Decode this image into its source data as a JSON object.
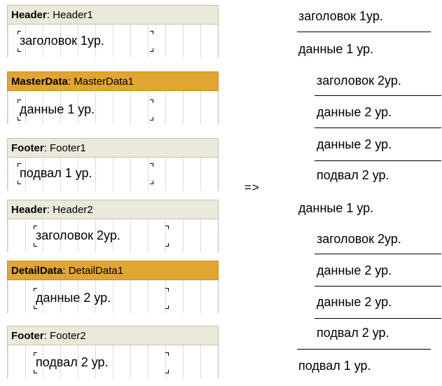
{
  "designer": {
    "bands": [
      {
        "type": "Header",
        "name": "Header1",
        "field": "заголовок 1ур.",
        "kind": "header"
      },
      {
        "type": "MasterData",
        "name": "MasterData1",
        "field": "данные 1 ур.",
        "kind": "data"
      },
      {
        "type": "Footer",
        "name": "Footer1",
        "field": "подвал 1 ур.",
        "kind": "header"
      },
      {
        "type": "Header",
        "name": "Header2",
        "field": "заголовок 2ур.",
        "kind": "header"
      },
      {
        "type": "DetailData",
        "name": "DetailData1",
        "field": "данные 2 ур.",
        "kind": "data"
      },
      {
        "type": "Footer",
        "name": "Footer2",
        "field": "подвал 2 ур.",
        "kind": "header"
      }
    ]
  },
  "arrow": "=>",
  "output": {
    "lines": [
      "заголовок 1ур.",
      "данные 1 ур.",
      "заголовок 2ур.",
      "данные 2 ур.",
      "данные 2 ур.",
      "подвал 2 ур.",
      "данные 1 ур.",
      "заголовок 2ур.",
      "данные 2 ур.",
      "данные 2 ур.",
      "подвал 2 ур.",
      "подвал 1 ур."
    ]
  }
}
